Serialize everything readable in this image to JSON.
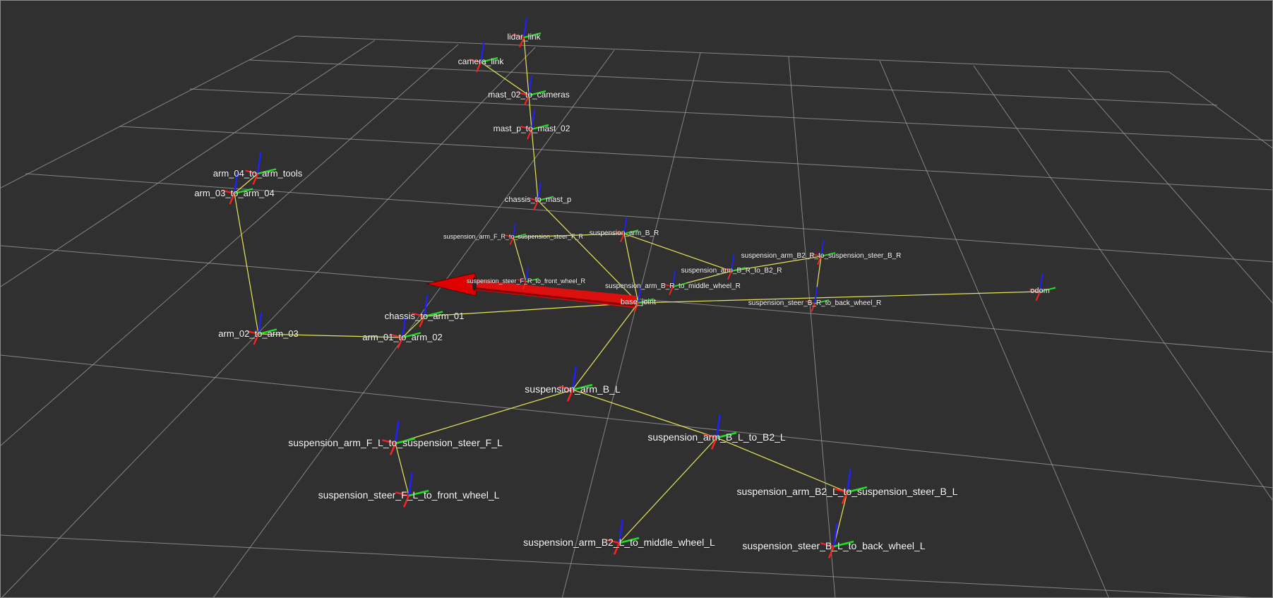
{
  "window": {
    "title": ""
  },
  "colors": {
    "background": "#303030",
    "grid": "#a0a0a0",
    "tf_link": "#e6e65a",
    "axis_x": "#ff2020",
    "axis_y": "#20e020",
    "axis_z": "#2020ff",
    "label": "#ffffff",
    "arrow": "#e00000"
  },
  "frames": [
    {
      "id": "lidar_link",
      "label": "lidar_link"
    },
    {
      "id": "camera_link",
      "label": "camera_link"
    },
    {
      "id": "mast_02_to_cameras",
      "label": "mast_02_to_cameras"
    },
    {
      "id": "mast_p_to_mast_02",
      "label": "mast_p_to_mast_02"
    },
    {
      "id": "chassis_to_mast_p",
      "label": "chassis_to_mast_p"
    },
    {
      "id": "arm_04_to_arm_tools",
      "label": "arm_04_to_arm_tools"
    },
    {
      "id": "arm_03_to_arm_04",
      "label": "arm_03_to_arm_04"
    },
    {
      "id": "suspension_arm_F_R_to_suspension_steer_F_R",
      "label": "suspension_arm_F_R_to_suspension_steer_F_R"
    },
    {
      "id": "suspension_arm_B_R",
      "label": "suspension_arm_B_R"
    },
    {
      "id": "suspension_steer_F_R_to_front_wheel_R",
      "label": "suspension_steer_F_R_to_front_wheel_R"
    },
    {
      "id": "suspension_arm_B2_R_to_suspension_steer_B_R",
      "label": "suspension_arm_B2_R_to_suspension_steer_B_R"
    },
    {
      "id": "suspension_arm_B_R_to_B2_R",
      "label": "suspension_arm_B_R_to_B2_R"
    },
    {
      "id": "suspension_arm_B_R_to_middle_wheel_R",
      "label": "suspension_arm_B_R_to_middle_wheel_R"
    },
    {
      "id": "base_joint",
      "label": "base_joint"
    },
    {
      "id": "suspension_steer_B_R_to_back_wheel_R",
      "label": "suspension_steer_B_R_to_back_wheel_R"
    },
    {
      "id": "odom",
      "label": "odom"
    },
    {
      "id": "chassis_to_arm_01",
      "label": "chassis_to_arm_01"
    },
    {
      "id": "arm_01_to_arm_02",
      "label": "arm_01_to_arm_02"
    },
    {
      "id": "arm_02_to_arm_03",
      "label": "arm_02_to_arm_03"
    },
    {
      "id": "suspension_arm_B_L",
      "label": "suspension_arm_B_L"
    },
    {
      "id": "suspension_arm_F_L_to_suspension_steer_F_L",
      "label": "suspension_arm_F_L_to_suspension_steer_F_L"
    },
    {
      "id": "suspension_arm_B_L_to_B2_L",
      "label": "suspension_arm_B_L_to_B2_L"
    },
    {
      "id": "suspension_steer_F_L_to_front_wheel_L",
      "label": "suspension_steer_F_L_to_front_wheel_L"
    },
    {
      "id": "suspension_arm_B2_L_to_suspension_steer_B_L",
      "label": "suspension_arm_B2_L_to_suspension_steer_B_L"
    },
    {
      "id": "suspension_arm_B2_L_to_middle_wheel_L",
      "label": "suspension_arm_B2_L_to_middle_wheel_L"
    },
    {
      "id": "suspension_steer_B_L_to_back_wheel_L",
      "label": "suspension_steer_B_L_to_back_wheel_L"
    }
  ],
  "tf_links": [
    [
      "lidar_link",
      "mast_02_to_cameras"
    ],
    [
      "camera_link",
      "mast_02_to_cameras"
    ],
    [
      "mast_02_to_cameras",
      "mast_p_to_mast_02"
    ],
    [
      "mast_p_to_mast_02",
      "chassis_to_mast_p"
    ],
    [
      "chassis_to_mast_p",
      "base_joint"
    ],
    [
      "arm_04_to_arm_tools",
      "arm_03_to_arm_04"
    ],
    [
      "arm_03_to_arm_04",
      "arm_02_to_arm_03"
    ],
    [
      "arm_02_to_arm_03",
      "arm_01_to_arm_02"
    ],
    [
      "arm_01_to_arm_02",
      "chassis_to_arm_01"
    ],
    [
      "chassis_to_arm_01",
      "base_joint"
    ],
    [
      "suspension_arm_F_R_to_suspension_steer_F_R",
      "suspension_arm_B_R"
    ],
    [
      "suspension_arm_F_R_to_suspension_steer_F_R",
      "suspension_steer_F_R_to_front_wheel_R"
    ],
    [
      "suspension_arm_B_R",
      "base_joint"
    ],
    [
      "suspension_arm_B_R",
      "suspension_arm_B_R_to_B2_R"
    ],
    [
      "suspension_arm_B_R_to_B2_R",
      "suspension_arm_B_R_to_middle_wheel_R"
    ],
    [
      "suspension_arm_B_R_to_B2_R",
      "suspension_arm_B2_R_to_suspension_steer_B_R"
    ],
    [
      "suspension_arm_B2_R_to_suspension_steer_B_R",
      "suspension_steer_B_R_to_back_wheel_R"
    ],
    [
      "base_joint",
      "odom"
    ],
    [
      "base_joint",
      "suspension_arm_B_L"
    ],
    [
      "suspension_arm_B_L",
      "suspension_arm_F_L_to_suspension_steer_F_L"
    ],
    [
      "suspension_arm_F_L_to_suspension_steer_F_L",
      "suspension_steer_F_L_to_front_wheel_L"
    ],
    [
      "suspension_arm_B_L",
      "suspension_arm_B_L_to_B2_L"
    ],
    [
      "suspension_arm_B_L_to_B2_L",
      "suspension_arm_B2_L_to_middle_wheel_L"
    ],
    [
      "suspension_arm_B_L_to_B2_L",
      "suspension_arm_B2_L_to_suspension_steer_B_L"
    ],
    [
      "suspension_arm_B2_L_to_suspension_steer_B_L",
      "suspension_steer_B_L_to_back_wheel_L"
    ]
  ]
}
